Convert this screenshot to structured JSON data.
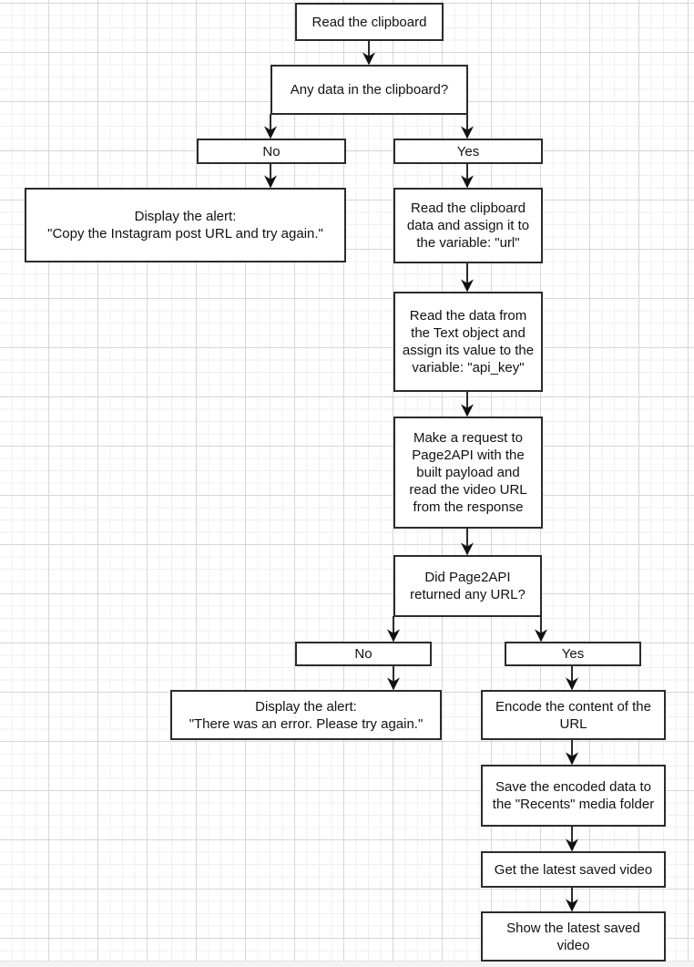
{
  "diagram": {
    "type": "flowchart",
    "nodes": {
      "read_clipboard": "Read the clipboard",
      "any_data": "Any data in the clipboard?",
      "no_1": "No",
      "yes_1": "Yes",
      "alert_copy": "Display the alert:\n\"Copy the Instagram post URL and try again.\"",
      "assign_url": "Read the clipboard\ndata and assign it to\nthe variable: \"url\"",
      "assign_api_key": "Read the data from\nthe Text object and\nassign its value to the\nvariable: \"api_key\"",
      "make_request": "Make a request to\nPage2API with the\nbuilt payload and\nread the video URL\nfrom the response",
      "returned_url": "Did Page2API\nreturned any URL?",
      "no_2": "No",
      "yes_2": "Yes",
      "alert_error": "Display the alert:\n\"There was an error. Please try again.\"",
      "encode": "Encode the content of the\nURL",
      "save_recents": "Save the encoded data to\nthe \"Recents\" media folder",
      "get_latest": "Get the latest saved video",
      "show_latest": "Show the latest saved\nvideo"
    },
    "edges": [
      [
        "read_clipboard",
        "any_data"
      ],
      [
        "any_data",
        "no_1"
      ],
      [
        "any_data",
        "yes_1"
      ],
      [
        "no_1",
        "alert_copy"
      ],
      [
        "yes_1",
        "assign_url"
      ],
      [
        "assign_url",
        "assign_api_key"
      ],
      [
        "assign_api_key",
        "make_request"
      ],
      [
        "make_request",
        "returned_url"
      ],
      [
        "returned_url",
        "no_2"
      ],
      [
        "returned_url",
        "yes_2"
      ],
      [
        "no_2",
        "alert_error"
      ],
      [
        "yes_2",
        "encode"
      ],
      [
        "encode",
        "save_recents"
      ],
      [
        "save_recents",
        "get_latest"
      ],
      [
        "get_latest",
        "show_latest"
      ]
    ],
    "colors": {
      "stroke": "#2b2b2b",
      "fill": "#ffffff",
      "text": "#111111",
      "grid_major": "#d6d6d6",
      "grid_minor": "#efefef"
    }
  }
}
